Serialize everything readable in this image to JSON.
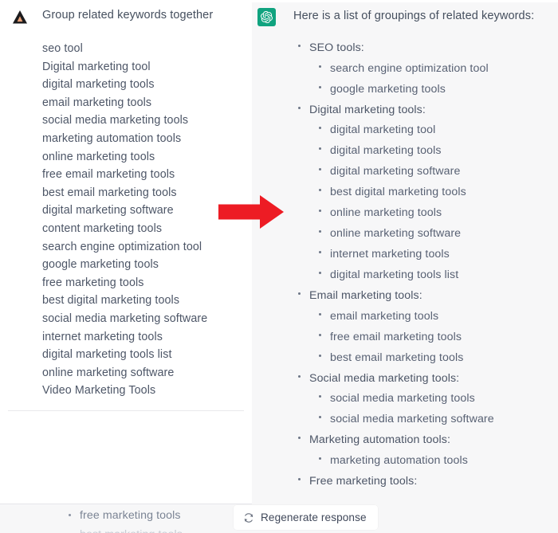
{
  "colors": {
    "arrow_red": "#ED1C24",
    "gpt_green": "#10A37F",
    "user_panel_bg": "#FFFFFF",
    "assistant_panel_bg": "#F7F7F8",
    "body_text": "#4D5667",
    "muted_text": "#7B8494"
  },
  "user_message": {
    "avatar_icon": "claude-triangle-icon",
    "prompt": "Group related keywords together",
    "keywords": [
      "seo tool",
      "Digital marketing tool",
      "digital marketing tools",
      "email marketing tools",
      "social media marketing tools",
      "marketing automation tools",
      "online marketing tools",
      "free email marketing tools",
      "best email marketing tools",
      "digital marketing software",
      "content marketing tools",
      "search engine optimization tool",
      "google marketing tools",
      "free marketing tools",
      "best digital marketing tools",
      "social media marketing software",
      "internet marketing tools",
      "digital marketing tools list",
      "online marketing software",
      "Video Marketing Tools"
    ]
  },
  "assistant_message": {
    "avatar_icon": "chatgpt-logo-icon",
    "intro": "Here is a list of groupings of related keywords:",
    "groups": [
      {
        "label": "SEO tools:",
        "items": [
          "search engine optimization tool",
          "google marketing tools"
        ]
      },
      {
        "label": "Digital marketing tools:",
        "items": [
          "digital marketing tool",
          "digital marketing tools",
          "digital marketing software",
          "best digital marketing tools",
          "online marketing tools",
          "online marketing software",
          "internet marketing tools",
          "digital marketing tools list"
        ]
      },
      {
        "label": "Email marketing tools:",
        "items": [
          "email marketing tools",
          "free email marketing tools",
          "best email marketing tools"
        ]
      },
      {
        "label": "Social media marketing tools:",
        "items": [
          "social media marketing tools",
          "social media marketing software"
        ]
      },
      {
        "label": "Marketing automation tools:",
        "items": [
          "marketing automation tools"
        ]
      },
      {
        "label": "Free marketing tools:",
        "items": []
      }
    ]
  },
  "overflow": {
    "visible_item": "free marketing tools",
    "clipped_item": "best marketing tools"
  },
  "regenerate": {
    "icon": "refresh-icon",
    "label": "Regenerate response"
  },
  "annotation": {
    "arrow_icon": "right-arrow-annotation"
  }
}
